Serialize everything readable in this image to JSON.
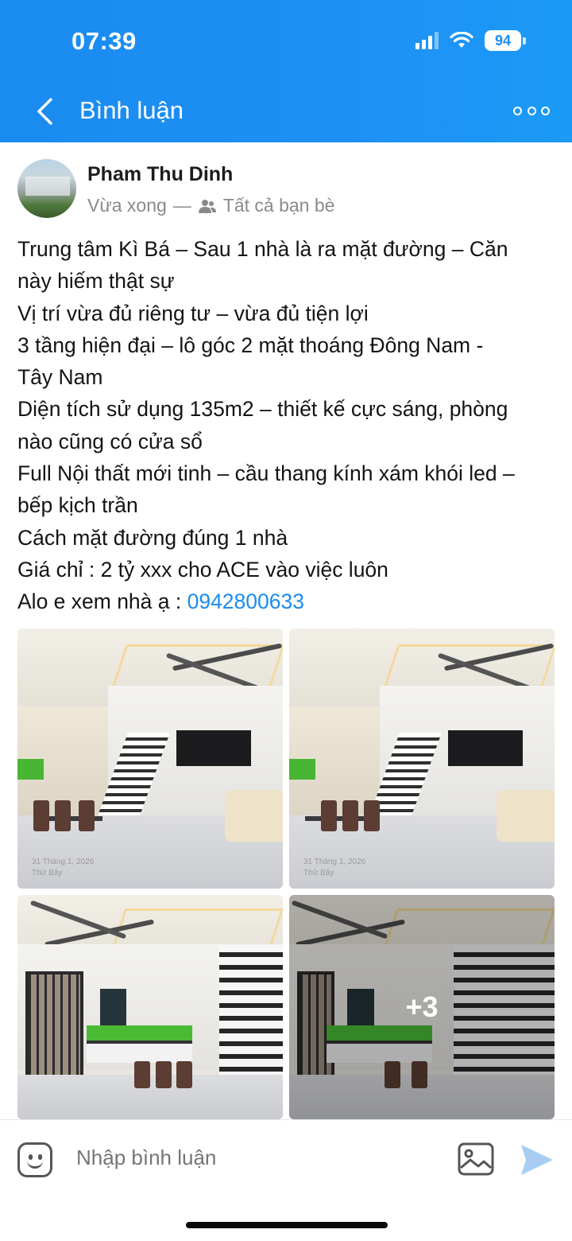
{
  "status_bar": {
    "time": "07:39",
    "battery": "94",
    "signal_icon": "cellular-signal-icon",
    "wifi_icon": "wifi-icon"
  },
  "header": {
    "title": "Bình luận",
    "back_icon": "chevron-left-icon",
    "more_icon": "more-options-icon",
    "background_color": "#1a8cf0"
  },
  "post": {
    "author": "Pham Thu Dinh",
    "time": "Vừa xong",
    "separator": "—",
    "audience_icon": "friends-icon",
    "audience": "Tất cả bạn bè",
    "lines": [
      "Trung tâm Kì Bá – Sau 1 nhà là ra mặt đường – Căn",
      "này hiếm thật sự",
      "Vị trí vừa đủ riêng tư – vừa đủ tiện lợi",
      "3 tầng hiện đại – lô góc 2 mặt thoáng Đông Nam -",
      "Tây Nam",
      "Diện tích sử dụng 135m2 – thiết kế cực sáng, phòng",
      "nào cũng có cửa sổ",
      "Full Nội thất mới tinh – cầu thang kính xám khói  led –",
      "bếp kịch trần",
      "Cách mặt đường đúng 1 nhà",
      "Giá chỉ : 2 tỷ xxx cho ACE vào việc luôn"
    ],
    "contact_prefix": "Alo e xem nhà ạ : ",
    "phone": "0942800633",
    "link_color": "#1a8cf0",
    "photos": {
      "stamp_date": "31 Tháng 1, 2026",
      "stamp_day": "Thứ Bảy",
      "more_count": "+3"
    }
  },
  "composer": {
    "placeholder": "Nhập bình luận",
    "emoji_icon": "emoji-icon",
    "image_icon": "image-icon",
    "send_icon": "send-icon"
  }
}
